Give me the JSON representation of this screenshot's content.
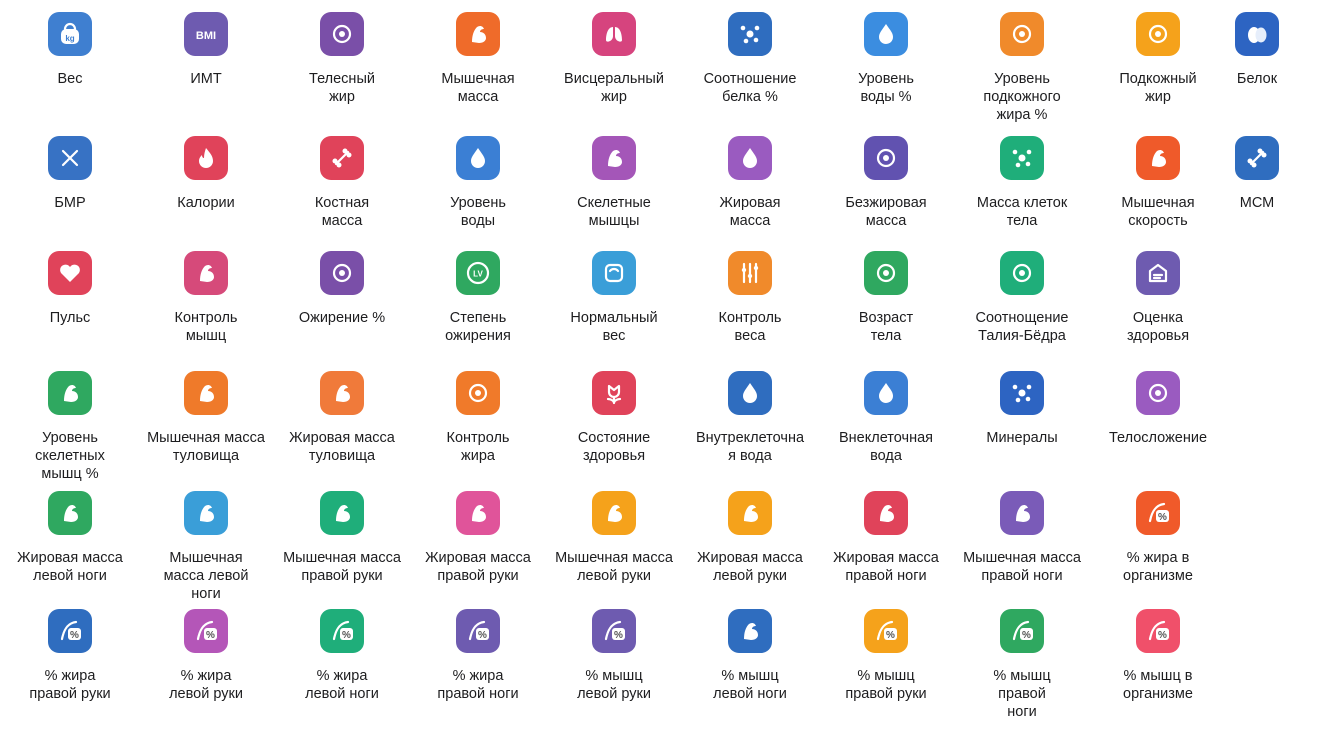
{
  "icons": [
    {
      "label": "Вес",
      "color": "#3f7fd0",
      "icon": "kettlebell-icon",
      "glyph": "kg"
    },
    {
      "label": "ИМТ",
      "color": "#6e5bb0",
      "icon": "bmi-icon",
      "glyph": "BMI"
    },
    {
      "label": "Телесный\nжир",
      "color": "#7a4fa8",
      "icon": "body-fat-icon",
      "glyph": ""
    },
    {
      "label": "Мышечная\nмасса",
      "color": "#ef6b2a",
      "icon": "muscle-icon",
      "glyph": ""
    },
    {
      "label": "Висцеральный\nжир",
      "color": "#d6447e",
      "icon": "lungs-icon",
      "glyph": ""
    },
    {
      "label": "Соотношение\nбелка %",
      "color": "#2f6dbf",
      "icon": "molecule-icon",
      "glyph": ""
    },
    {
      "label": "Уровень\nводы %",
      "color": "#3b8de0",
      "icon": "water-drop-icon",
      "glyph": ""
    },
    {
      "label": "Уровень\nподкожного\nжира %",
      "color": "#f08a2b",
      "icon": "subcutaneous-fat-icon",
      "glyph": ""
    },
    {
      "label": "Подкожный\nжир",
      "color": "#f5a21b",
      "icon": "fat-layer-icon",
      "glyph": ""
    },
    {
      "label": "Белок",
      "color": "#2d64c2",
      "icon": "eggs-icon",
      "glyph": ""
    },
    {
      "label": "БМР",
      "color": "#3772c4",
      "icon": "dna-icon",
      "glyph": ""
    },
    {
      "label": "Калории",
      "color": "#e0435a",
      "icon": "flame-icon",
      "glyph": ""
    },
    {
      "label": "Костная\nмасса",
      "color": "#e0435a",
      "icon": "bone-icon",
      "glyph": ""
    },
    {
      "label": "Уровень\nводы",
      "color": "#3b7fd4",
      "icon": "water-drops-icon",
      "glyph": ""
    },
    {
      "label": "Скелетные\nмышцы",
      "color": "#a456b8",
      "icon": "skeletal-muscle-icon",
      "glyph": ""
    },
    {
      "label": "Жировая\nмасса",
      "color": "#9a5bc0",
      "icon": "fat-drop-icon",
      "glyph": ""
    },
    {
      "label": "Безжировая\nмасса",
      "color": "#6152b0",
      "icon": "lean-mass-icon",
      "glyph": ""
    },
    {
      "label": "Масса клеток\nтела",
      "color": "#1fae7a",
      "icon": "cells-icon",
      "glyph": ""
    },
    {
      "label": "Мышечная\nскорость",
      "color": "#ef5a2a",
      "icon": "muscle-speed-icon",
      "glyph": ""
    },
    {
      "label": "МСМ",
      "color": "#2f6dbf",
      "icon": "bone-mineral-icon",
      "glyph": ""
    },
    {
      "label": "Пульс",
      "color": "#e0435a",
      "icon": "heart-icon",
      "glyph": ""
    },
    {
      "label": "Контроль\nмышц",
      "color": "#d64a7a",
      "icon": "muscle-control-icon",
      "glyph": ""
    },
    {
      "label": "Ожирение %",
      "color": "#7a4fa8",
      "icon": "obesity-icon",
      "glyph": ""
    },
    {
      "label": "Степень\nожирения",
      "color": "#2fa860",
      "icon": "level-badge-icon",
      "glyph": "LV"
    },
    {
      "label": "Нормальный\nвес",
      "color": "#3a9ed8",
      "icon": "scale-icon",
      "glyph": ""
    },
    {
      "label": "Контроль\nвеса",
      "color": "#f08a2b",
      "icon": "sliders-icon",
      "glyph": ""
    },
    {
      "label": "Возраст\nтела",
      "color": "#2fa860",
      "icon": "body-age-icon",
      "glyph": ""
    },
    {
      "label": "Соотнощение\nТалия-Бёдра",
      "color": "#1fae7a",
      "icon": "waist-hip-icon",
      "glyph": ""
    },
    {
      "label": "Оценка\nздоровья",
      "color": "#6e5bb0",
      "icon": "health-report-icon",
      "glyph": ""
    },
    {
      "label": "Уровень\nскелетных\nмышц %",
      "color": "#2fa860",
      "icon": "skeletal-level-icon",
      "glyph": ""
    },
    {
      "label": "Мышечная масса\nтуловища",
      "color": "#ef7a2a",
      "icon": "trunk-muscle-icon",
      "glyph": ""
    },
    {
      "label": "Жировая масса\nтуловища",
      "color": "#f07a3a",
      "icon": "trunk-fat-icon",
      "glyph": ""
    },
    {
      "label": "Контроль\nжира",
      "color": "#f07a2a",
      "icon": "fat-control-icon",
      "glyph": ""
    },
    {
      "label": "Состояние\nздоровья",
      "color": "#e0435a",
      "icon": "tulip-icon",
      "glyph": ""
    },
    {
      "label": "Внутреклеточна\nя вода",
      "color": "#2f6dbf",
      "icon": "intracellular-water-icon",
      "glyph": ""
    },
    {
      "label": "Внеклеточная\nвода",
      "color": "#3b7fd4",
      "icon": "extracellular-water-icon",
      "glyph": ""
    },
    {
      "label": "Минералы",
      "color": "#2d64c2",
      "icon": "minerals-icon",
      "glyph": ""
    },
    {
      "label": "Телосложение",
      "color": "#9a5bc0",
      "icon": "body-scan-icon",
      "glyph": ""
    },
    {
      "label": "Жировая масса\nлевой ноги",
      "color": "#2fa860",
      "icon": "left-leg-fat-icon",
      "glyph": ""
    },
    {
      "label": "Мышечная\nмасса левой\nноги",
      "color": "#3a9ed8",
      "icon": "left-leg-muscle-icon",
      "glyph": ""
    },
    {
      "label": "Мышечная масса\nправой руки",
      "color": "#1fae7a",
      "icon": "right-arm-muscle-icon",
      "glyph": ""
    },
    {
      "label": "Жировая масса\nправой руки",
      "color": "#e0549a",
      "icon": "right-arm-fat-icon",
      "glyph": ""
    },
    {
      "label": "Мышечная масса\nлевой руки",
      "color": "#f5a21b",
      "icon": "left-arm-muscle-icon",
      "glyph": ""
    },
    {
      "label": "Жировая масса\nлевой руки",
      "color": "#f5a21b",
      "icon": "left-arm-fat-icon",
      "glyph": ""
    },
    {
      "label": "Жировая масса\nправой ноги",
      "color": "#e0435a",
      "icon": "right-leg-fat-icon",
      "glyph": ""
    },
    {
      "label": "Мышечная масса\nправой ноги",
      "color": "#7a5bb8",
      "icon": "right-leg-muscle-icon",
      "glyph": ""
    },
    {
      "label": "% жира в\nорганизме",
      "color": "#f05a2a",
      "icon": "body-fat-percent-icon",
      "glyph": "%"
    },
    {
      "label": "% жира\nправой руки",
      "color": "#2f6dbf",
      "icon": "right-arm-fat-percent-icon",
      "glyph": "%"
    },
    {
      "label": "% жира\nлевой руки",
      "color": "#b456b8",
      "icon": "left-arm-fat-percent-icon",
      "glyph": "%"
    },
    {
      "label": "% жира\nлевой ноги",
      "color": "#1fae7a",
      "icon": "left-leg-fat-percent-icon",
      "glyph": "%"
    },
    {
      "label": "% жира\nправой ноги",
      "color": "#6e5bb0",
      "icon": "right-leg-fat-percent-icon",
      "glyph": "%"
    },
    {
      "label": "% мышц\nлевой руки",
      "color": "#6e5bb0",
      "icon": "left-arm-muscle-percent-icon",
      "glyph": "%"
    },
    {
      "label": "% мышц\nлевой ноги",
      "color": "#2f6dbf",
      "icon": "left-leg-muscle-percent-icon",
      "glyph": ""
    },
    {
      "label": "% мышц\nправой руки",
      "color": "#f5a21b",
      "icon": "right-arm-muscle-percent-icon",
      "glyph": "%"
    },
    {
      "label": "% мышц\nправой\nноги",
      "color": "#2fa860",
      "icon": "right-leg-muscle-percent-icon",
      "glyph": "%"
    },
    {
      "label": "% мышц в\nорганизме",
      "color": "#f0506a",
      "icon": "body-muscle-percent-icon",
      "glyph": "%"
    }
  ]
}
